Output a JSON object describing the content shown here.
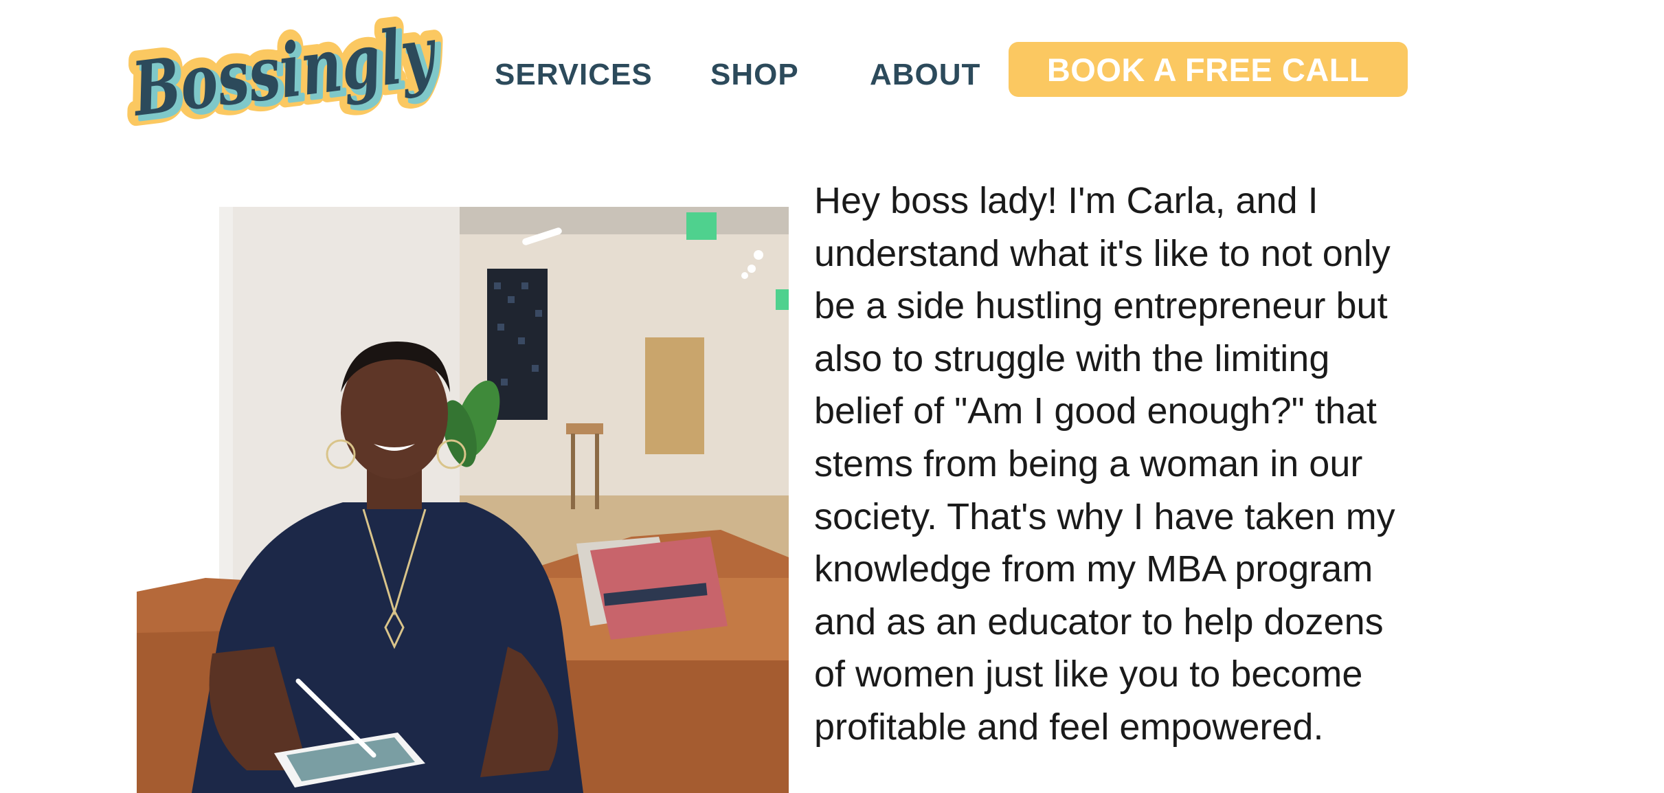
{
  "header": {
    "logo_text": "Bossingly",
    "nav": {
      "services": "SERVICES",
      "shop": "SHOP",
      "about": "ABOUT"
    },
    "cta_label": "BOOK A FREE CALL"
  },
  "colors": {
    "brand_navy": "#2c4a5b",
    "brand_yellow": "#fbc861",
    "brand_teal": "#7fc8c9",
    "text": "#1a1a1a",
    "background": "#ffffff"
  },
  "intro": {
    "lines": [
      "Hey boss lady! I'm Carla, and I",
      "understand what it's like to not only",
      "be a side hustling entrepreneur but",
      "also to struggle with the limiting",
      "belief of \"Am I good enough?\" that",
      "stems from being a woman in our",
      "society. That's why I have taken my",
      "knowledge from my MBA program",
      "and as an educator to help dozens",
      "of women just like you to become",
      "profitable and feel empowered."
    ]
  }
}
